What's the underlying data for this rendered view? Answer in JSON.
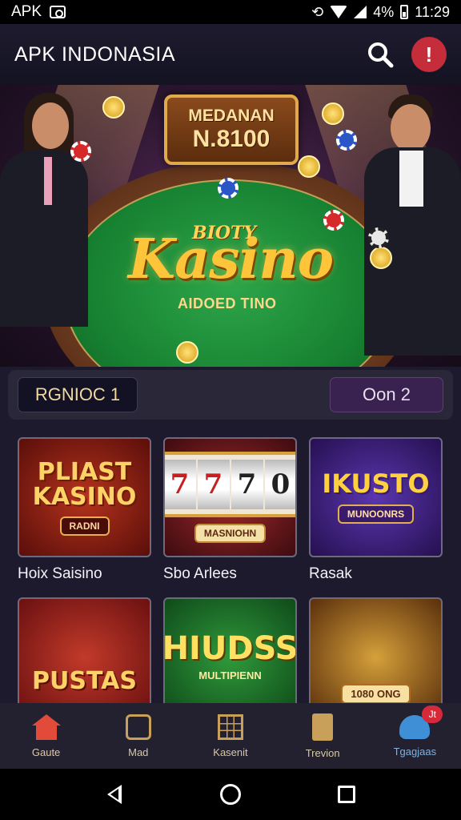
{
  "status_bar": {
    "carrier": "APK",
    "battery": "4%",
    "time": "11:29"
  },
  "app_bar": {
    "title": "APK INDONASIA"
  },
  "hero": {
    "sign_line1": "MEDANAN",
    "sign_line2": "N.8100",
    "logo_small": "BIOTY",
    "logo": "Kasino",
    "logo_sub": "AIDOED TINO"
  },
  "filters": {
    "left": "RGNIOC 1",
    "right": "Oon 2"
  },
  "games": [
    {
      "title": "PLIAST KASINO",
      "tag": "RADNI",
      "caption": "Hoix Saisino"
    },
    {
      "reels": [
        "7",
        "7",
        "7",
        "0"
      ],
      "tag": "MASNIOHN",
      "caption": "Sbo Arlees"
    },
    {
      "title": "IKUSTO",
      "tag": "MUNOONRS",
      "caption": "Rasak"
    },
    {
      "title": "PUSTAS",
      "tag": "",
      "caption": ""
    },
    {
      "title": "HIUDSS",
      "tag": "MULTIPIENN",
      "caption": ""
    },
    {
      "title": "",
      "tag": "1080 ONG",
      "caption": ""
    }
  ],
  "bottom_nav": [
    {
      "label": "Gaute",
      "icon": "home-icon"
    },
    {
      "label": "Mad",
      "icon": "genie-icon"
    },
    {
      "label": "Kasenit",
      "icon": "grid-icon"
    },
    {
      "label": "Trevion",
      "icon": "coupon-icon"
    },
    {
      "label": "Tgagjaas",
      "icon": "support-icon",
      "badge": "Jt"
    }
  ],
  "colors": {
    "accent_red": "#c62d3a",
    "gold": "#ffc53a",
    "felt": "#178232",
    "surface": "#1c1a2c"
  }
}
